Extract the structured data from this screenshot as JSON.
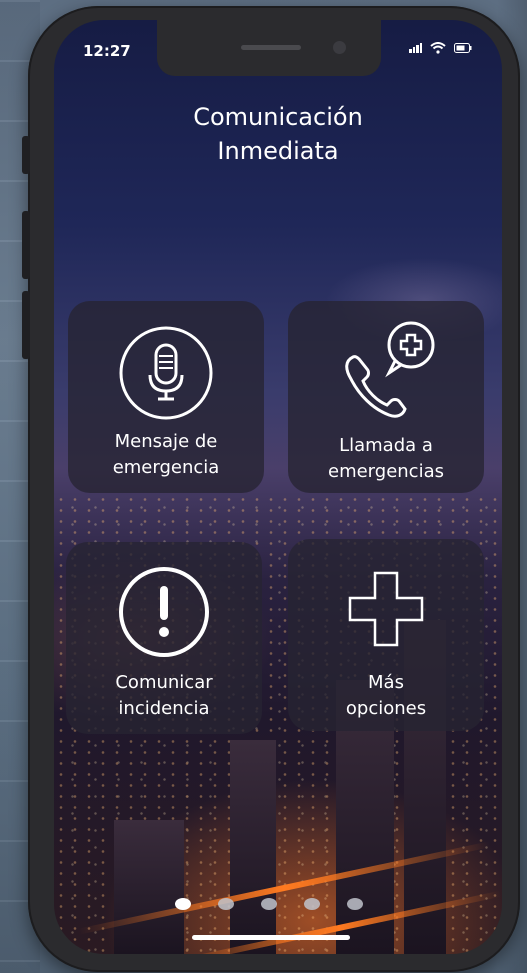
{
  "status_bar": {
    "time": "12:27"
  },
  "header": {
    "title_line1": "Comunicación",
    "title_line2": "Inmediata"
  },
  "tiles": [
    {
      "line1": "Mensaje de",
      "line2": "emergencia",
      "icon": "microphone-icon"
    },
    {
      "line1": "Llamada a",
      "line2": "emergencias",
      "icon": "phone-plus-icon"
    },
    {
      "line1": "Comunicar",
      "line2": "incidencia",
      "icon": "alert-icon"
    },
    {
      "line1": "Más",
      "line2": "opciones",
      "icon": "plus-outline-icon"
    }
  ],
  "pager": {
    "pages": 5,
    "active": 1
  },
  "colors": {
    "tile_bg": "#26243280",
    "text": "#ffffff"
  }
}
